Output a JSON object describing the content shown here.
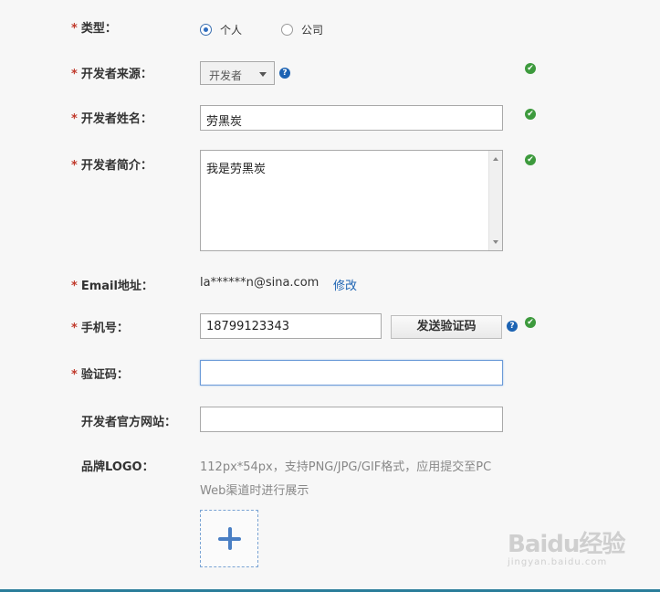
{
  "form": {
    "type": {
      "label": "类型：",
      "options": [
        "个人",
        "公司"
      ],
      "selected": "个人"
    },
    "source": {
      "label": "开发者来源：",
      "value": "开发者"
    },
    "name": {
      "label": "开发者姓名：",
      "value": "劳黑炭"
    },
    "intro": {
      "label": "开发者简介：",
      "value": "我是劳黑炭"
    },
    "email": {
      "label": "Email地址：",
      "value": "la******n@sina.com",
      "edit_link": "修改"
    },
    "phone": {
      "label": "手机号：",
      "value": "18799123343",
      "send_code_button": "发送验证码"
    },
    "code": {
      "label": "验证码：",
      "value": ""
    },
    "website": {
      "label": "开发者官方网站：",
      "value": ""
    },
    "logo": {
      "label": "品牌LOGO：",
      "hint_line1": "112px*54px，支持PNG/JPG/GIF格式，应用提交至PC",
      "hint_line2": "Web渠道时进行展示"
    }
  },
  "required_mark": "*",
  "help_glyph": "?",
  "ok_glyph": "✔",
  "watermark": {
    "main": "Baidu经验",
    "sub": "jingyan.baidu.com"
  },
  "colors": {
    "required": "#c0392b",
    "link": "#1c63b3",
    "ok": "#3d9a3d",
    "accent_bar": "#2a7d9a"
  }
}
